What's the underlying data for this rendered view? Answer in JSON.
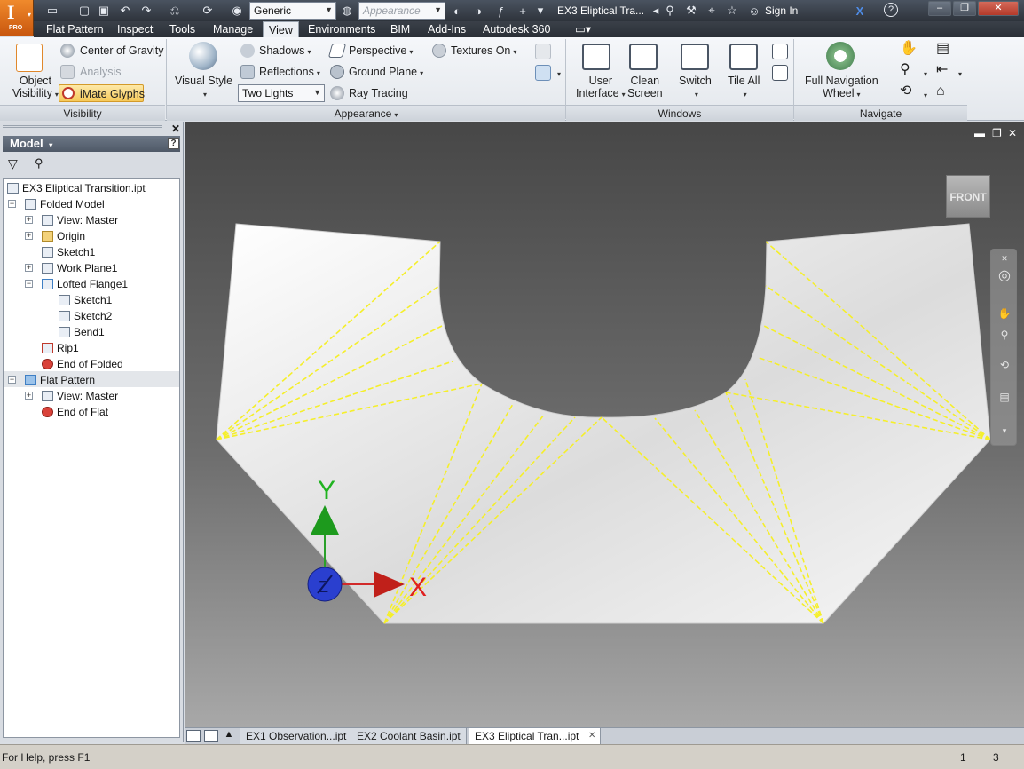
{
  "titlebar": {
    "logo_letter": "I",
    "logo_sub": "PRO",
    "material_value": "Generic",
    "appearance_placeholder": "Appearance",
    "document_title": "EX3 Eliptical Tra...",
    "sign_in": "Sign In",
    "help": "?",
    "quick_access_icons": [
      "new-icon",
      "open-icon",
      "save-icon",
      "undo-icon",
      "redo-icon",
      "return-icon",
      "update-icon",
      "material-icon",
      "fx-icon",
      "plus-icon",
      "customize-icon"
    ]
  },
  "tabs": [
    "Flat Pattern",
    "Inspect",
    "Tools",
    "Manage",
    "View",
    "Environments",
    "BIM",
    "Add-Ins",
    "Autodesk 360"
  ],
  "active_tab": "View",
  "ribbon": {
    "visibility": {
      "title": "Visibility",
      "object_visibility": [
        "Object",
        "Visibility"
      ],
      "center_of_gravity": "Center of Gravity",
      "analysis": "Analysis",
      "imate_glyphs": "iMate Glyphs"
    },
    "appearance": {
      "title": "Appearance",
      "visual_style": "Visual Style",
      "shadows": "Shadows",
      "reflections": "Reflections",
      "lighting": "Two Lights",
      "perspective": "Perspective",
      "ground_plane": "Ground Plane",
      "ray_tracing": "Ray Tracing",
      "textures": "Textures On"
    },
    "windows": {
      "title": "Windows",
      "user_interface": [
        "User",
        "Interface"
      ],
      "clean_screen": [
        "Clean",
        "Screen"
      ],
      "switch": "Switch",
      "tile_all": "Tile All"
    },
    "navigate": {
      "title": "Navigate",
      "full_nav_wheel": [
        "Full Navigation",
        "Wheel"
      ]
    }
  },
  "browser": {
    "title": "Model",
    "help": "?",
    "tree": [
      {
        "label": "EX3 Eliptical Transition.ipt",
        "icon": "part-icon"
      },
      {
        "label": "Folded Model",
        "icon": "folded-model-icon"
      },
      {
        "label": "View: Master",
        "icon": "view-icon"
      },
      {
        "label": "Origin",
        "icon": "folder-icon"
      },
      {
        "label": "Sketch1",
        "icon": "sketch-icon"
      },
      {
        "label": "Work Plane1",
        "icon": "workplane-icon"
      },
      {
        "label": "Lofted Flange1",
        "icon": "lofted-flange-icon"
      },
      {
        "label": "Sketch1",
        "icon": "sketch-icon"
      },
      {
        "label": "Sketch2",
        "icon": "sketch-icon"
      },
      {
        "label": "Bend1",
        "icon": "bend-icon"
      },
      {
        "label": "Rip1",
        "icon": "rip-icon"
      },
      {
        "label": "End of Folded",
        "icon": "end-of-part-icon"
      },
      {
        "label": "Flat Pattern",
        "icon": "flat-pattern-icon"
      },
      {
        "label": "View: Master",
        "icon": "view-icon"
      },
      {
        "label": "End of Flat",
        "icon": "end-of-part-icon"
      }
    ]
  },
  "viewport": {
    "viewcube_label": "FRONT",
    "axis_x": "X",
    "axis_y": "Y",
    "axis_z": "Z",
    "fold_line_color": "#f5ef2a",
    "part_color": "#f2f2f2"
  },
  "document_tabs": [
    {
      "label": "EX1 Observation...ipt",
      "active": false
    },
    {
      "label": "EX2 Coolant Basin.ipt",
      "active": false
    },
    {
      "label": "EX3 Eliptical Tran...ipt",
      "active": true
    }
  ],
  "status": {
    "help_text": "For Help, press F1",
    "count_a": "1",
    "count_b": "3"
  }
}
